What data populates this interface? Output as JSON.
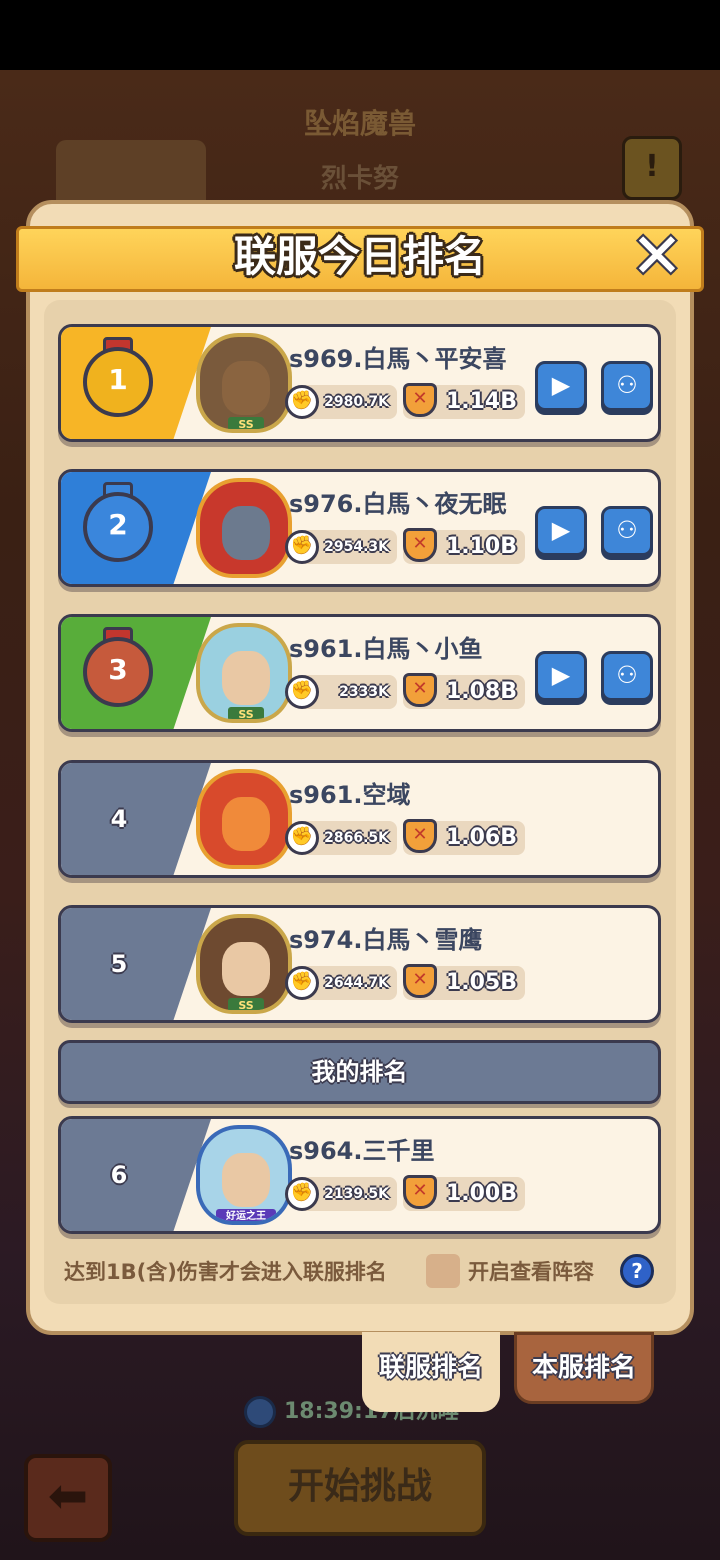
{
  "background": {
    "boss_name": "坠焰魔兽",
    "boss_sub": "烈卡努",
    "timer_text": "18:39:17后沉睡",
    "start_button": "开始挑战"
  },
  "panel": {
    "title": "联服今日排名",
    "my_rank_label": "我的排名",
    "note": "达到1B(含)伤害才会进入联服排名",
    "view_lineup_label": "开启查看阵容",
    "help_symbol": "?"
  },
  "tabs": {
    "cross_server": "联服排名",
    "local_server": "本服排名"
  },
  "rows": [
    {
      "rank": "1",
      "name": "s969.白馬丶平安喜",
      "power": "2980.7K",
      "damage": "1.14B",
      "color": "#f7b526",
      "medal_color": "#f0b21e",
      "has_buttons": true,
      "tag": "SS"
    },
    {
      "rank": "2",
      "name": "s976.白馬丶夜无眠",
      "power": "2954.3K",
      "damage": "1.10B",
      "color": "#2f7fd8",
      "medal_color": "#3a86dc",
      "has_buttons": true,
      "tag": ""
    },
    {
      "rank": "3",
      "name": "s961.白馬丶小鱼",
      "power": "2333K",
      "damage": "1.08B",
      "color": "#58ad3a",
      "medal_color": "#c65a3c",
      "has_buttons": true,
      "tag": "SS"
    },
    {
      "rank": "4",
      "name": "s961.空域",
      "power": "2866.5K",
      "damage": "1.06B",
      "color": "#6c7a94",
      "medal_color": "",
      "has_buttons": false,
      "tag": ""
    },
    {
      "rank": "5",
      "name": "s974.白馬丶雪鹰",
      "power": "2644.7K",
      "damage": "1.05B",
      "color": "#6c7a94",
      "medal_color": "",
      "has_buttons": false,
      "tag": "SS"
    }
  ],
  "my_row": {
    "rank": "6",
    "name": "s964.三千里",
    "power": "2139.5K",
    "damage": "1.00B",
    "color": "#6c7a94",
    "tag": "好运之王"
  }
}
